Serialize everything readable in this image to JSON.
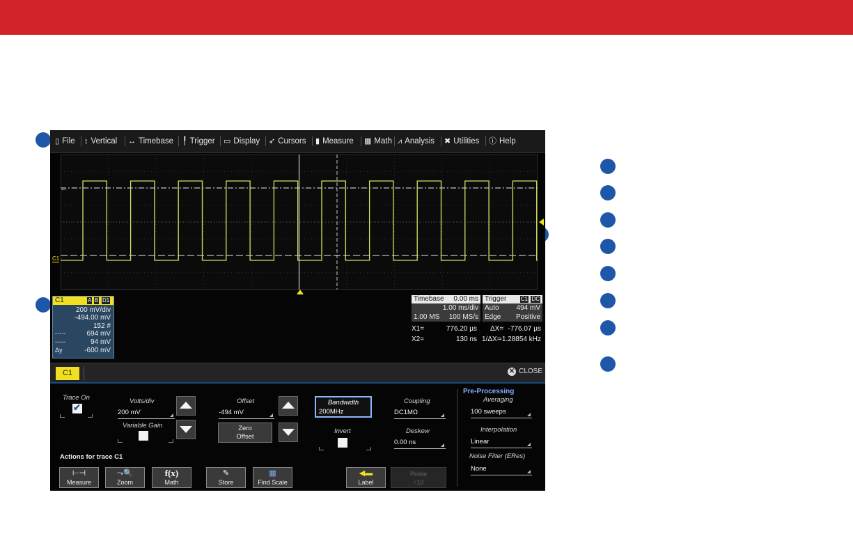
{
  "menu": {
    "items": [
      {
        "label": "File",
        "icon": "file-icon"
      },
      {
        "label": "Vertical",
        "icon": "vertical-arrows-icon"
      },
      {
        "label": "Timebase",
        "icon": "horizontal-arrows-icon"
      },
      {
        "label": "Trigger",
        "icon": "trigger-flag-icon"
      },
      {
        "label": "Display",
        "icon": "display-icon"
      },
      {
        "label": "Cursors",
        "icon": "cursor-icon"
      },
      {
        "label": "Measure",
        "icon": "measure-icon"
      },
      {
        "label": "Math",
        "icon": "calculator-icon"
      },
      {
        "label": "Analysis",
        "icon": "chart-icon"
      },
      {
        "label": "Utilities",
        "icon": "tools-icon"
      },
      {
        "label": "Help",
        "icon": "info-icon"
      }
    ]
  },
  "grid": {
    "channel_marker": "C1",
    "trace_color": "#d8e060"
  },
  "channel_descriptor": {
    "name": "C1",
    "badges": [
      "A",
      "B",
      "D1"
    ],
    "volts_div": "200 mV/div",
    "offset": "-494.00 mV",
    "sweeps": "152 #",
    "cursor1_value": "694 mV",
    "cursor2_value": "94 mV",
    "delta_label": "Δy",
    "delta_value": "-600 mV"
  },
  "timebase": {
    "title": "Timebase",
    "delay": "0.00 ms",
    "time_div": "1.00 ms/div",
    "samples": "1.00 MS",
    "sample_rate": "100 MS/s"
  },
  "trigger": {
    "title": "Trigger",
    "source": "C1",
    "coupling": "DC",
    "mode": "Auto",
    "level": "494 mV",
    "type": "Edge",
    "slope": "Positive"
  },
  "cursors": {
    "x1_label": "X1=",
    "x1_value": "776.20 µs",
    "dx_label": "ΔX=",
    "dx_value": "-776.07 µs",
    "x2_label": "X2=",
    "x2_value": "130 ns",
    "inv_label": "1/ΔX=",
    "inv_value": "-1.28854 kHz"
  },
  "dialog": {
    "tab": "C1",
    "close_label": "CLOSE",
    "trace_on_label": "Trace On",
    "volts_div_label": "Volts/div",
    "volts_div_value": "200 mV",
    "variable_gain_label": "Variable Gain",
    "offset_label": "Offset",
    "offset_value": "-494 mV",
    "zero_offset_label_1": "Zero",
    "zero_offset_label_2": "Offset",
    "bandwidth_label": "Bandwidth",
    "bandwidth_value": "200MHz",
    "invert_label": "Invert",
    "coupling_label": "Coupling",
    "coupling_value": "DC1MΩ",
    "deskew_label": "Deskew",
    "deskew_value": "0.00 ns",
    "preprocessing_title": "Pre-Processing",
    "averaging_label": "Averaging",
    "averaging_value": "100 sweeps",
    "interpolation_label": "Interpolation",
    "interpolation_value": "Linear",
    "noise_filter_label": "Noise Filter (ERes)",
    "noise_filter_value": "None",
    "actions_title": "Actions for trace C1",
    "actions": [
      "Measure",
      "Zoom",
      "Math",
      "Store",
      "Find Scale"
    ],
    "label_button": "Label",
    "probe_label_1": "Probe",
    "probe_label_2": "÷10"
  }
}
